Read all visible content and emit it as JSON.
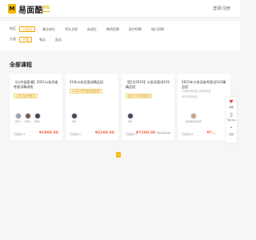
{
  "header": {
    "logo_mark": "M",
    "logo_text": "易面酷",
    "nav_course": "课程",
    "login": "登录/注册"
  },
  "filters": {
    "region_label": "地区",
    "regions": [
      "公务员",
      "事业单位",
      "军队文职",
      "选调生",
      "教师招聘",
      "医疗招聘",
      "银行招聘"
    ],
    "type_label": "分类",
    "types": [
      "不限",
      "笔试",
      "面试"
    ]
  },
  "section": {
    "title": "全部课程"
  },
  "courses": [
    {
      "title": "【公共益面课】2021公务员省考面试精讲班",
      "tag": "公务员省考面试",
      "teachers": [
        {
          "name": "老师1"
        },
        {
          "name": "老师2"
        },
        {
          "name": "老师3"
        }
      ],
      "enrolled": "已报名23",
      "price": "¥1980.00",
      "price_old": ""
    },
    {
      "title": "21年公务员面试精品班",
      "tag": "21年公务员面试精品班",
      "teachers": [
        {
          "name": "老师"
        }
      ],
      "enrolled": "已报名50",
      "price": "¥2280.00",
      "price_old": ""
    },
    {
      "title": "【民主2021】公务员面试1V1精品班",
      "tag": "结业1V1面试精品",
      "teachers": [
        {
          "name": "老师"
        }
      ],
      "enrolled": "已报名12",
      "price": "¥7280.00",
      "price_old": "¥8280.00"
    },
    {
      "title": "2021年公务员省考面试1V1精品班",
      "date1": "31年05月1日-05月30日",
      "date2": "2021年05月...",
      "tag": "",
      "teachers": [
        {
          "name": "面试辅导员老师"
        }
      ],
      "enrolled": "已报名18",
      "price": "¥7...",
      "price_old": ""
    }
  ],
  "sidebar": {
    "items": [
      {
        "icon": "heart-icon",
        "label": "收藏"
      },
      {
        "icon": "phone-icon",
        "label": "下载 App"
      },
      {
        "icon": "top-icon",
        "label": "顶部"
      }
    ]
  },
  "pager": {
    "current": "1"
  },
  "colors": {
    "accent": "#f2b705",
    "price": "#f36b4a",
    "sidebar_icon": "#e04b3b"
  }
}
